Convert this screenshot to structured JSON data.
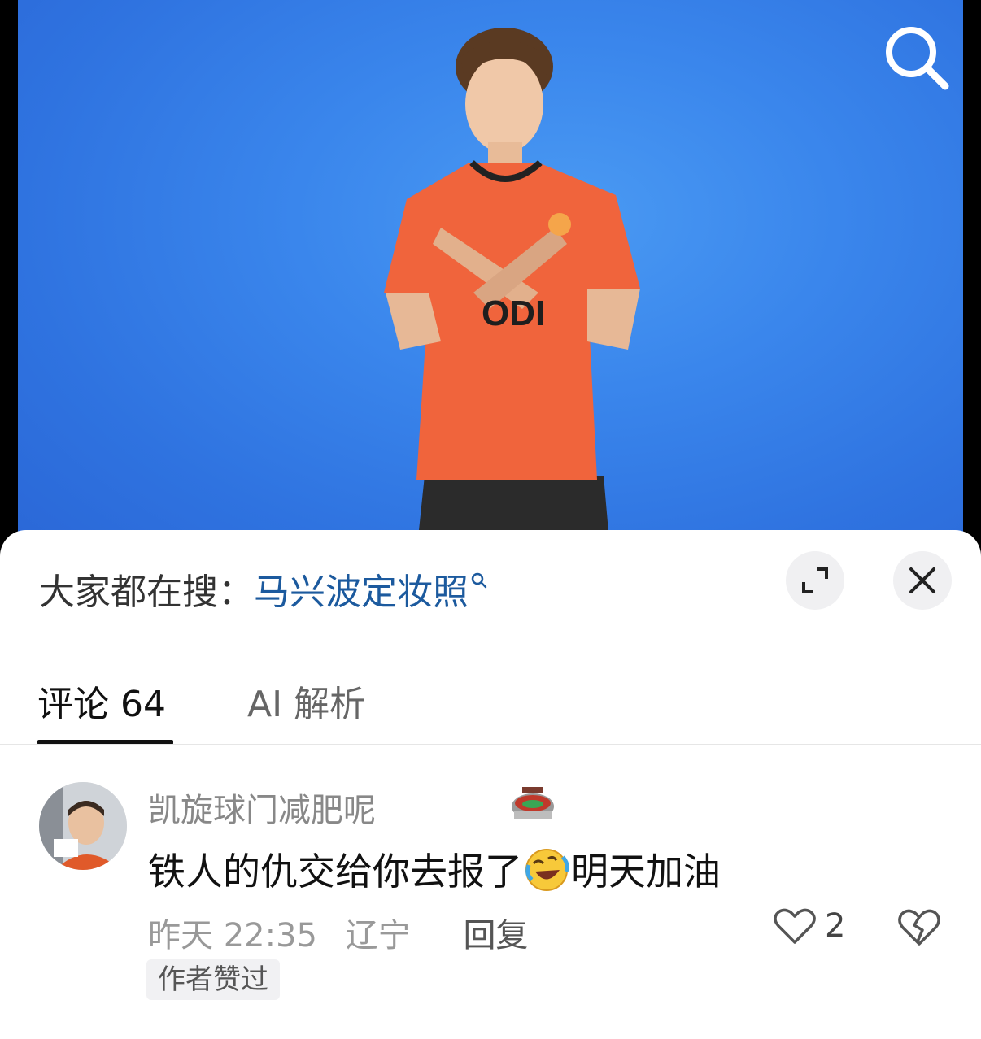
{
  "trending": {
    "prefix": "大家都在搜：",
    "query": "马兴波定妆照"
  },
  "tabs": [
    {
      "label": "评论 64",
      "active": true
    },
    {
      "label": "AI 解析",
      "active": false
    }
  ],
  "comment": {
    "username": "凯旋球门减肥呢",
    "text_before_emoji": "铁人的仇交给你去报了",
    "text_after_emoji": "明天加油",
    "time": "昨天 22:35",
    "location": "辽宁",
    "reply_label": "回复",
    "like_count": "2",
    "author_liked_label": "作者赞过",
    "icons": [
      "stadium-icon",
      "rolling-laughing-emoji",
      "heart-icon",
      "broken-heart-icon"
    ]
  },
  "colors": {
    "photo_background": "#3a86ec",
    "jersey": "#f0643c",
    "query_link": "#1c5a9e"
  }
}
